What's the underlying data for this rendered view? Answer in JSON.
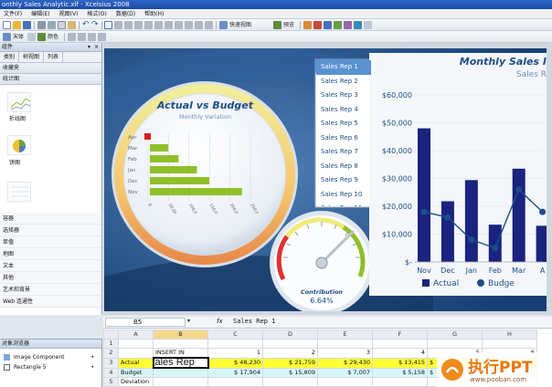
{
  "window": {
    "title": "onthly Sales Analytic.xlf - Xcelsius 2008"
  },
  "menu": [
    "文件(F)",
    "编辑(E)",
    "视图(V)",
    "格式(O)",
    "数据(D)",
    "帮助(H)"
  ],
  "toolbar": {
    "quick_view": "快速视图",
    "preview": "预览",
    "font": "宋体",
    "format_label": "颜色"
  },
  "components_panel": {
    "title": "组件",
    "tabs": [
      "类别",
      "树视图",
      "列表"
    ],
    "categories_top": [
      "收藏夹",
      "统计图"
    ],
    "items": [
      {
        "label": "折线图"
      },
      {
        "label": "饼图"
      }
    ],
    "categories_bottom": [
      "容器",
      "选择器",
      "单值",
      "地图",
      "文本",
      "其他",
      "艺术和背景",
      "Web 连通性"
    ]
  },
  "object_browser": {
    "title": "对象浏览器",
    "items": [
      "Image Component",
      "Rectangle 5"
    ]
  },
  "gauge_chart": {
    "title": "Actual vs Budget",
    "subtitle": "Monthly Variation",
    "y_labels": [
      "Apr",
      "Mar",
      "Feb",
      "Jan",
      "Dec",
      "Nov"
    ],
    "x_labels": [
      "0",
      "50,000",
      "100,000",
      "150,000",
      "200,000",
      "250,000"
    ]
  },
  "dial": {
    "label": "Contribution",
    "value": "6.64%",
    "level": 0.066
  },
  "reps": [
    "Sales Rep 1",
    "Sales Rep 2",
    "Sales Rep 3",
    "Sales Rep 4",
    "Sales Rep 5",
    "Sales Rep 6",
    "Sales Rep 7",
    "Sales Rep 8",
    "Sales Rep 9",
    "Sales Rep 10",
    "Sales Rep 11"
  ],
  "chart_data": {
    "type": "bar",
    "title": "Monthly Sales I",
    "subtitle": "Sales R",
    "categories": [
      "Nov",
      "Dec",
      "Jan",
      "Feb",
      "Mar",
      "A"
    ],
    "y_ticks": [
      "$-",
      "$10,000",
      "$20,000",
      "$30,000",
      "$40,000",
      "$50,000",
      "$60,000"
    ],
    "ylim": [
      0,
      60000
    ],
    "series": [
      {
        "name": "Actual",
        "values": [
          48000,
          21800,
          29400,
          13400,
          33500,
          13000
        ],
        "color": "#1a237e"
      },
      {
        "name": "Budge",
        "values": [
          18000,
          16000,
          8000,
          5000,
          26000,
          18000
        ],
        "color": "#1e4d87"
      }
    ],
    "legend_position": "bottom"
  },
  "sheet": {
    "cell_ref": "B5",
    "fx": "fx",
    "formula": "Sales Rep 1",
    "edit_value": "ales Rep",
    "col_headers": [
      "",
      "A",
      "B",
      "C",
      "D",
      "E",
      "F",
      "G",
      "H"
    ],
    "rows": [
      [
        "1",
        "",
        "",
        "",
        "",
        "",
        "",
        "",
        ""
      ],
      [
        "2",
        "",
        "INSERT IN",
        "1",
        "2",
        "3",
        "4",
        "5",
        "6"
      ],
      [
        "3",
        "Actual",
        "",
        "$ 48,230",
        "$ 21,759",
        "$ 29,430",
        "$ 13,415",
        "$",
        ""
      ],
      [
        "4",
        "Budget",
        "",
        "$ 17,904",
        "$ 15,809",
        "$ 7,007",
        "$ 5,158",
        "$",
        ""
      ],
      [
        "5",
        "Deviation",
        "",
        "",
        "",
        "",
        "",
        "",
        ""
      ]
    ]
  },
  "watermark": {
    "text": "执行PPT",
    "url": "www.pooban.com"
  },
  "colors": {
    "accent": "#1e4d87",
    "bar_green": "#8fbf2a",
    "bar_navy": "#1a237e",
    "highlight": "#ffff33"
  }
}
